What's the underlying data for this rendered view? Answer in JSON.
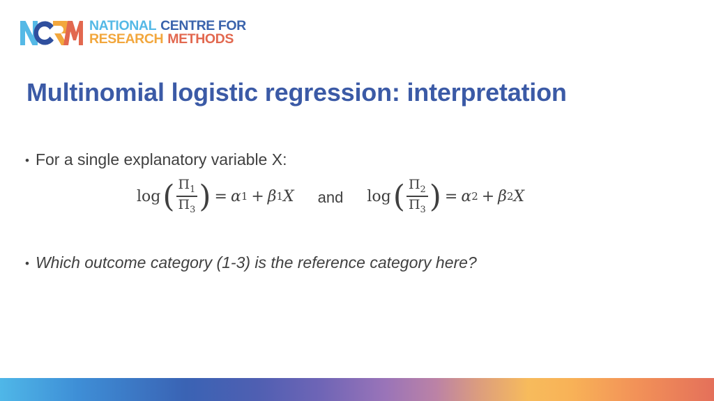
{
  "logo": {
    "mark_letters": [
      "N",
      "C",
      "R",
      "M"
    ],
    "mark_colors": [
      "#55b9e6",
      "#3a63ac",
      "#f2a73d",
      "#e2684f"
    ],
    "line1_part1": "NATIONAL",
    "line1_part2": "CENTRE FOR",
    "line2_part1": "RESEARCH",
    "line2_part2": "METHODS"
  },
  "slide": {
    "title": "Multinomial logistic regression: interpretation",
    "title_color": "#3b5aa6",
    "body_color": "#404040",
    "background": "#ffffff"
  },
  "bullets": [
    {
      "marker": "•",
      "text": "For a single explanatory variable X:",
      "style": "normal"
    },
    {
      "marker": "•",
      "text": "Which outcome category (1-3) is the reference category here?",
      "style": "italic"
    }
  ],
  "equations": {
    "conjunction": "and",
    "left": {
      "fn": "log",
      "open_paren": "(",
      "close_paren": ")",
      "numerator_symbol": "Π",
      "numerator_subscript": "1",
      "denominator_symbol": "Π",
      "denominator_subscript": "3",
      "equals": "=",
      "alpha": "α",
      "alpha_subscript": "1",
      "plus": "+",
      "beta": "β",
      "beta_subscript": "1",
      "variable": "X",
      "plain": "log(Π₁/Π₃) = α₁ + β₁X"
    },
    "right": {
      "fn": "log",
      "open_paren": "(",
      "close_paren": ")",
      "numerator_symbol": "Π",
      "numerator_subscript": "2",
      "denominator_symbol": "Π",
      "denominator_subscript": "3",
      "equals": "=",
      "alpha": "α",
      "alpha_subscript": "2",
      "plus": "+",
      "beta": "β",
      "beta_subscript": "2",
      "variable": "X",
      "plain": "log(Π₂/Π₃) = α₂ + β₂X"
    }
  },
  "footer": {
    "gradient_stops": [
      "#4fb7e8",
      "#3a63b4",
      "#6f65b6",
      "#9a74b8",
      "#f7bb5c",
      "#e4705a"
    ]
  }
}
